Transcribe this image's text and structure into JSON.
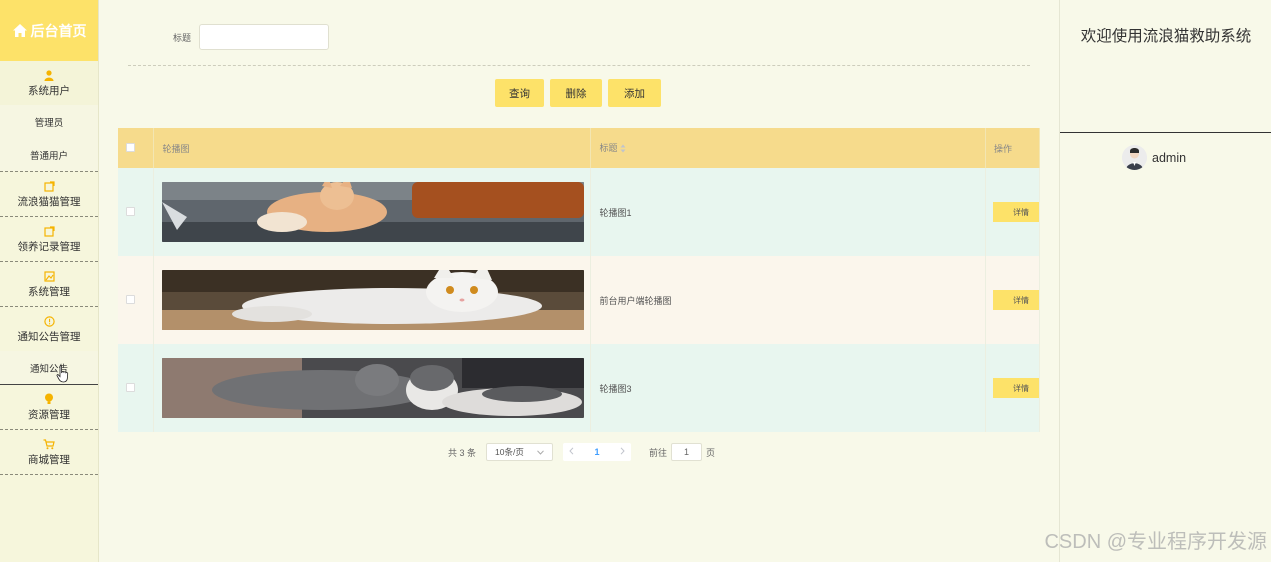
{
  "sidebar": {
    "brand": "后台首页",
    "groups": [
      {
        "label": "系统用户",
        "icon": "user-icon",
        "children": [
          "管理员",
          "普通用户"
        ]
      },
      {
        "label": "流浪猫猫管理",
        "icon": "edit-icon",
        "children": []
      },
      {
        "label": "领养记录管理",
        "icon": "edit-icon",
        "children": []
      },
      {
        "label": "系统管理",
        "icon": "image-icon",
        "children": []
      },
      {
        "label": "通知公告管理",
        "icon": "info-icon",
        "children": [
          "通知公告"
        ]
      },
      {
        "label": "资源管理",
        "icon": "bulb-icon",
        "children": []
      },
      {
        "label": "商城管理",
        "icon": "cart-icon",
        "children": []
      }
    ]
  },
  "search": {
    "label": "标题",
    "value": "",
    "placeholder": ""
  },
  "toolbar": {
    "query": "查询",
    "delete": "删除",
    "add": "添加"
  },
  "table": {
    "headers": {
      "image": "轮播图",
      "title": "标题",
      "operation": "操作"
    },
    "rows": [
      {
        "title": "轮播图1",
        "detail": "详情"
      },
      {
        "title": "前台用户端轮播图",
        "detail": "详情"
      },
      {
        "title": "轮播图3",
        "detail": "详情"
      }
    ]
  },
  "pagination": {
    "total": "共 3 条",
    "page_size": "10条/页",
    "current": "1",
    "goto_prefix": "前往",
    "goto_value": "1",
    "goto_suffix": "页"
  },
  "right_panel": {
    "welcome": "欢迎使用流浪猫救助系统",
    "username": "admin"
  },
  "watermark": "CSDN @专业程序开发源",
  "colors": {
    "accent": "#fde269",
    "header": "#f6db8c",
    "row_a": "#e8f6ef",
    "row_b": "#fbf6ec",
    "link": "#409eff"
  }
}
